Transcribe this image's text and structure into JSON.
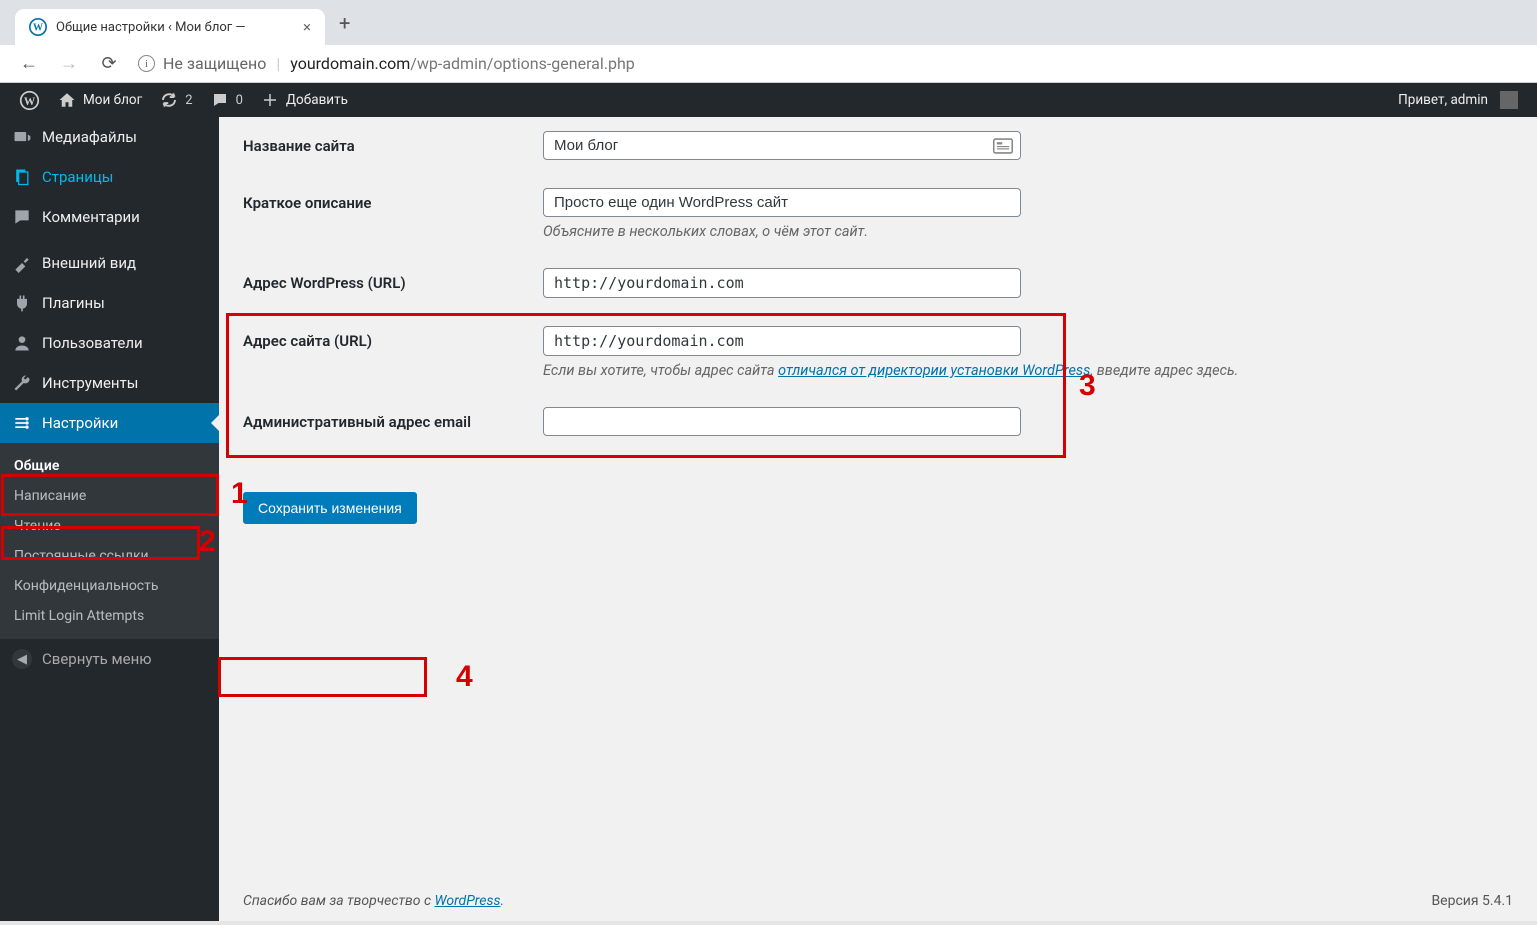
{
  "browser": {
    "tab_title": "Общие настройки ‹ Мои блог —",
    "security_label": "Не защищено",
    "url_domain": "yourdomain.com",
    "url_path": "/wp-admin/options-general.php"
  },
  "adminbar": {
    "site_name": "Мои блог",
    "updates_count": "2",
    "comments_count": "0",
    "new_label": "Добавить",
    "greeting": "Привет, admin"
  },
  "sidebar": {
    "items": [
      {
        "icon": "media",
        "label": "Медиафайлы"
      },
      {
        "icon": "pages",
        "label": "Страницы",
        "highlight": true
      },
      {
        "icon": "comments",
        "label": "Комментарии"
      },
      {
        "icon": "appearance",
        "label": "Внешний вид"
      },
      {
        "icon": "plugins",
        "label": "Плагины"
      },
      {
        "icon": "users",
        "label": "Пользователи"
      },
      {
        "icon": "tools",
        "label": "Инструменты"
      },
      {
        "icon": "settings",
        "label": "Настройки",
        "current": true
      }
    ],
    "submenu": [
      {
        "label": "Общие",
        "current": true
      },
      {
        "label": "Написание"
      },
      {
        "label": "Чтение"
      },
      {
        "label": "Постоянные ссылки"
      },
      {
        "label": "Конфиденциальность"
      },
      {
        "label": "Limit Login Attempts"
      }
    ],
    "collapse_label": "Свернуть меню"
  },
  "form": {
    "site_title_label": "Название сайта",
    "site_title_value": "Мои блог",
    "tagline_label": "Краткое описание",
    "tagline_value": "Просто еще один WordPress сайт",
    "tagline_desc": "Объясните в нескольких словах, о чём этот сайт.",
    "wp_url_label": "Адрес WordPress (URL)",
    "wp_url_value": "http://yourdomain.com",
    "site_url_label": "Адрес сайта (URL)",
    "site_url_value": "http://yourdomain.com",
    "site_url_desc_pre": "Если вы хотите, чтобы адрес сайта ",
    "site_url_desc_link": "отличался от директории установки WordPress",
    "site_url_desc_post": ", введите адрес здесь.",
    "admin_email_label": "Административный адрес email",
    "admin_email_value": "",
    "submit_label": "Сохранить изменения"
  },
  "footer": {
    "thanks_pre": "Спасибо вам за творчество с ",
    "thanks_link": "WordPress",
    "version": "Версия 5.4.1"
  },
  "annotations": {
    "n1": "1",
    "n2": "2",
    "n3": "3",
    "n4": "4"
  }
}
